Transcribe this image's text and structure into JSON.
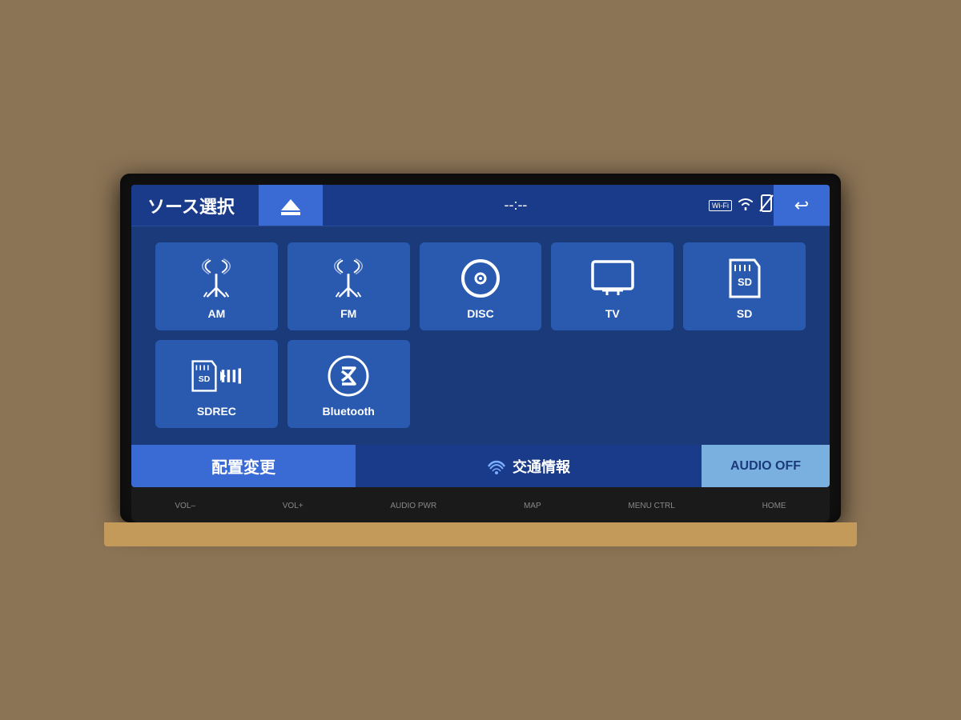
{
  "device": {
    "screen_bg": "#1a3a7a"
  },
  "header": {
    "title": "ソース選択",
    "eject_label": "▲",
    "time": "--:--",
    "wifi_label": "Wi-Fi",
    "back_label": "↩"
  },
  "source_buttons": [
    {
      "id": "am",
      "label": "AM",
      "icon": "antenna"
    },
    {
      "id": "fm",
      "label": "FM",
      "icon": "antenna"
    },
    {
      "id": "disc",
      "label": "DISC",
      "icon": "disc"
    },
    {
      "id": "tv",
      "label": "TV",
      "icon": "tv"
    },
    {
      "id": "sd",
      "label": "SD",
      "icon": "sd"
    },
    {
      "id": "sdrec",
      "label": "SDREC",
      "icon": "sdrec"
    },
    {
      "id": "bluetooth",
      "label": "Bluetooth",
      "icon": "bluetooth"
    }
  ],
  "bottom_bar": {
    "arrange_label": "配置変更",
    "traffic_label": "交通情報",
    "traffic_icon": "📻",
    "audio_off_label": "AUDIO OFF"
  },
  "physical_buttons": [
    {
      "id": "vol-minus",
      "label": "VOL–",
      "sub": ""
    },
    {
      "id": "vol-plus",
      "label": "VOL+",
      "sub": ""
    },
    {
      "id": "audio",
      "label": "AUDIO",
      "sub": "PWR"
    },
    {
      "id": "map",
      "label": "MAP",
      "sub": ""
    },
    {
      "id": "menu",
      "label": "MENU",
      "sub": "CTRL"
    },
    {
      "id": "home",
      "label": "HOME",
      "sub": ""
    }
  ]
}
